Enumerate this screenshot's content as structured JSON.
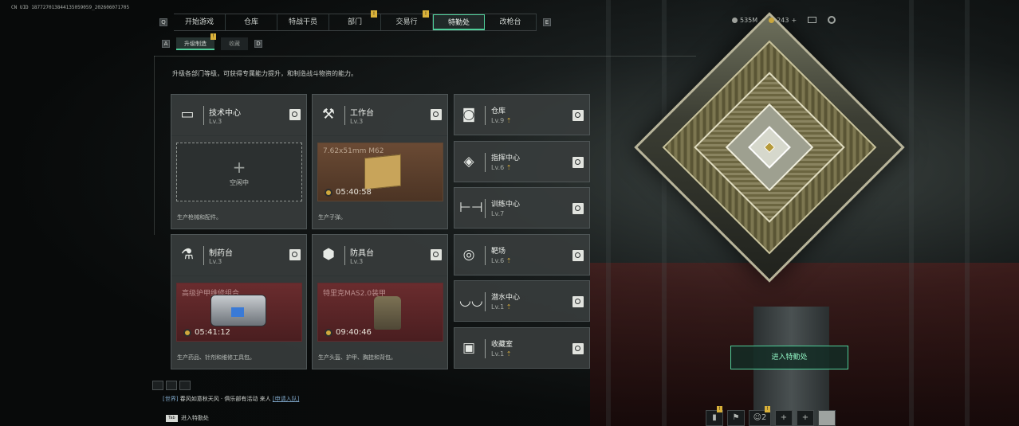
{
  "uid_text": "CN UID 1877270138441350590​59_2026060717​05",
  "nav": {
    "tabs": [
      "开始游戏",
      "仓库",
      "特战干员",
      "部门",
      "交易行",
      "特勤处",
      "改枪台"
    ],
    "active_index": 5,
    "flags": {
      "3": "!",
      "4": "!"
    },
    "left_key": "Q",
    "right_key": "E"
  },
  "resources": {
    "coins": "535M",
    "currency": "243"
  },
  "subnav": {
    "left_key": "A",
    "right_key": "D",
    "tabs": [
      "升级制造",
      "收藏"
    ],
    "flag": "!"
  },
  "description": "升级各部门等级，可获得专属能力提升，和制造战斗物资的能力。",
  "cards": [
    {
      "name": "技术中心",
      "level": "Lv.3",
      "slot_type": "empty",
      "plus": "+",
      "idle": "空闲中",
      "foot": "生产枪械和配件。"
    },
    {
      "name": "工作台",
      "level": "Lv.3",
      "slot_type": "brown",
      "item": "7.62x51mm M62",
      "timer": "05:40:58",
      "foot": "生产子弹。"
    },
    {
      "name": "制药台",
      "level": "Lv.3",
      "slot_type": "red",
      "item": "高级护甲维修组合",
      "timer": "05:41:12",
      "foot": "生产药品、针剂和维修工具包。"
    },
    {
      "name": "防具台",
      "level": "Lv.3",
      "slot_type": "red",
      "item": "特里克MAS2.0装甲",
      "timer": "09:40:46",
      "foot": "生产头盔、护甲、胸挂和背包。"
    }
  ],
  "departments": [
    {
      "name": "仓库",
      "level": "Lv.9",
      "upgrade": true
    },
    {
      "name": "指挥中心",
      "level": "Lv.6",
      "upgrade": true
    },
    {
      "name": "训练中心",
      "level": "Lv.7",
      "upgrade": false
    },
    {
      "name": "靶场",
      "level": "Lv.6",
      "upgrade": true
    },
    {
      "name": "潜水中心",
      "level": "Lv.1",
      "upgrade": true
    },
    {
      "name": "收藏室",
      "level": "Lv.1",
      "upgrade": true
    }
  ],
  "enter_button": "进入特勤处",
  "chat": {
    "channel": "[世界]",
    "message": "春风如意秋天风 · 俱乐部有活动 来人",
    "link": "[申请入队]"
  },
  "hint": {
    "key": "Tab",
    "label": "进入特勤处"
  },
  "bottom_bar": {
    "friends": "2",
    "flag": "!"
  },
  "icons": {
    "tech": "monitor-icon",
    "workbench": "hammer-icon",
    "pharmacy": "microscope-icon",
    "armor": "armor-plates-icon",
    "warehouse": "vault-icon",
    "command": "diamond-target-icon",
    "training": "dumbbell-icon",
    "range": "target-icon",
    "diving": "goggles-icon",
    "collection": "portrait-icon"
  },
  "colors": {
    "accent": "#4fcf9a",
    "gold": "#d0a83c"
  }
}
